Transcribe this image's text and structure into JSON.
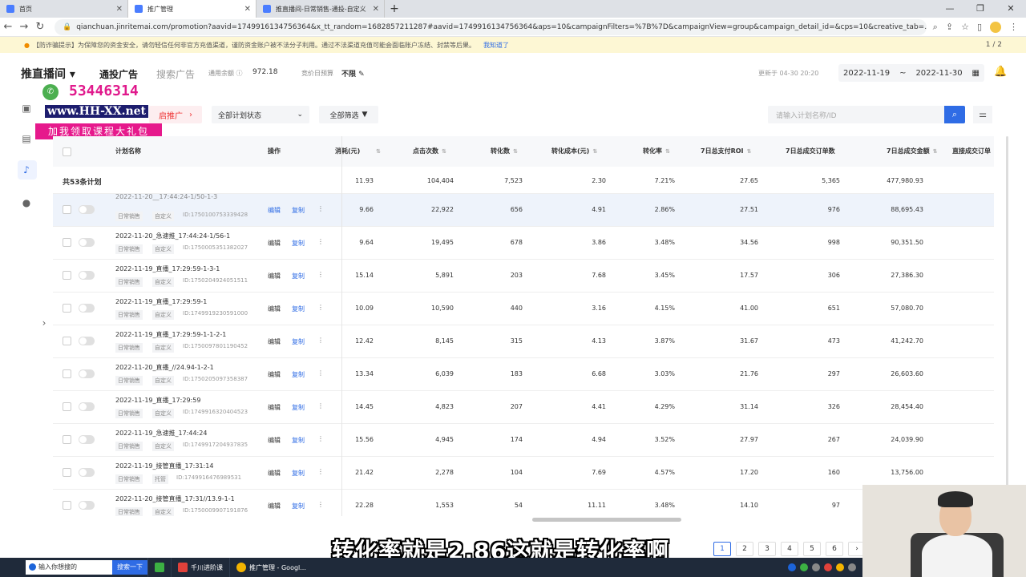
{
  "browser": {
    "tabs": [
      {
        "title": "首页"
      },
      {
        "title": "推广管理"
      },
      {
        "title": "推直播间-日常销售-通投-自定义"
      }
    ],
    "url": "qianchuan.jinritemai.com/promotion?aavid=1749916134756364&x_tt_random=1682857211287#aavid=1749916134756364&aps=10&campaignFilters=%7B%7D&campaignView=group&campaign_detail_id=&cps=10&creative_tab=..."
  },
  "warning": {
    "text": "【防诈骗提示】为保障您的资金安全，请勿轻信任何非官方充值渠道，谨防资金账户被不法分子利用。通过不法渠道充值可能会面临账户冻结、封禁等后果。",
    "link": "我知道了",
    "pager": "1  /  2"
  },
  "header": {
    "title": "推直播间 ▾",
    "tab_active": "通投广告",
    "tab_other": "搜索广告",
    "balance_label": "通用余额 ⓘ",
    "balance_value": "972.18",
    "budget_label": "竞价日预算",
    "budget_value": "不限 ✎",
    "updated": "更新于 04-30 20:20",
    "date_start": "2022-11-19",
    "date_sep": "~",
    "date_end": "2022-11-30"
  },
  "filters": {
    "start_btn": "启推广",
    "status_select": "全部计划状态",
    "all_filter": "全部筛选",
    "search_placeholder": "请输入计划名称/ID"
  },
  "watermark": {
    "phone": "53446314",
    "site": "www.HH-XX.net",
    "gift": "加我领取课程大礼包"
  },
  "table": {
    "headers": {
      "name": "计划名称",
      "op": "操作",
      "cost": "消耗(元)",
      "clicks": "点击次数",
      "conv": "转化数",
      "conv_cost": "转化成本(元)",
      "conv_rate": "转化率",
      "roi7": "7日总支付ROI",
      "orders7": "7日总成交订单数",
      "gmv7": "7日总成交金额",
      "direct": "直接成交订单"
    },
    "summary": {
      "label": "共53条计划",
      "cost": "11.93",
      "clicks": "104,404",
      "conv": "7,523",
      "conv_cost": "2.30",
      "conv_rate": "7.21%",
      "roi7": "27.65",
      "orders7": "5,365",
      "gmv7": "477,980.93"
    },
    "edit_label": "编辑",
    "copy_label": "复制",
    "rows": [
      {
        "name": "2022-11-20__17:44:24-1/50-1-3",
        "tag1": "日常销售",
        "tag2": "自定义",
        "id": "ID:1750100753339428",
        "cost": "9.66",
        "clicks": "22,922",
        "conv": "656",
        "conv_cost": "4.91",
        "conv_rate": "2.86%",
        "roi7": "27.51",
        "orders7": "976",
        "gmv7": "88,695.43",
        "editable": true
      },
      {
        "name": "2022-11-20_急速推_17:44:24-1/56-1",
        "tag1": "日常销售",
        "tag2": "自定义",
        "id": "ID:1750005351382027",
        "cost": "9.64",
        "clicks": "19,495",
        "conv": "678",
        "conv_cost": "3.86",
        "conv_rate": "3.48%",
        "roi7": "34.56",
        "orders7": "998",
        "gmv7": "90,351.50",
        "editable": false
      },
      {
        "name": "2022-11-19_直播_17:29:59-1-3-1",
        "tag1": "日常销售",
        "tag2": "自定义",
        "id": "ID:1750204924051511",
        "cost": "15.14",
        "clicks": "5,891",
        "conv": "203",
        "conv_cost": "7.68",
        "conv_rate": "3.45%",
        "roi7": "17.57",
        "orders7": "306",
        "gmv7": "27,386.30",
        "editable": false
      },
      {
        "name": "2022-11-19_直播_17:29:59-1",
        "tag1": "日常销售",
        "tag2": "自定义",
        "id": "ID:1749919230591000",
        "cost": "10.09",
        "clicks": "10,590",
        "conv": "440",
        "conv_cost": "3.16",
        "conv_rate": "4.15%",
        "roi7": "41.00",
        "orders7": "651",
        "gmv7": "57,080.70",
        "editable": false
      },
      {
        "name": "2022-11-19_直播_17:29:59-1-1-2-1",
        "tag1": "日常销售",
        "tag2": "自定义",
        "id": "ID:1750097801190452",
        "cost": "12.42",
        "clicks": "8,145",
        "conv": "315",
        "conv_cost": "4.13",
        "conv_rate": "3.87%",
        "roi7": "31.67",
        "orders7": "473",
        "gmv7": "41,242.70",
        "editable": false
      },
      {
        "name": "2022-11-20_直播_//24.94-1-2-1",
        "tag1": "日常销售",
        "tag2": "自定义",
        "id": "ID:1750205097358387",
        "cost": "13.34",
        "clicks": "6,039",
        "conv": "183",
        "conv_cost": "6.68",
        "conv_rate": "3.03%",
        "roi7": "21.76",
        "orders7": "297",
        "gmv7": "26,603.60",
        "editable": false
      },
      {
        "name": "2022-11-19_直播_17:29:59",
        "tag1": "日常销售",
        "tag2": "自定义",
        "id": "ID:1749916320404523",
        "cost": "14.45",
        "clicks": "4,823",
        "conv": "207",
        "conv_cost": "4.41",
        "conv_rate": "4.29%",
        "roi7": "31.14",
        "orders7": "326",
        "gmv7": "28,454.40",
        "editable": false
      },
      {
        "name": "2022-11-19_急速推_17:44:24",
        "tag1": "日常销售",
        "tag2": "自定义",
        "id": "ID:1749917204937835",
        "cost": "15.56",
        "clicks": "4,945",
        "conv": "174",
        "conv_cost": "4.94",
        "conv_rate": "3.52%",
        "roi7": "27.97",
        "orders7": "267",
        "gmv7": "24,039.90",
        "editable": false
      },
      {
        "name": "2022-11-19_接管直播_17:31:14",
        "tag1": "日常销售",
        "tag2": "托管",
        "id": "ID:1749916476989531",
        "cost": "21.42",
        "clicks": "2,278",
        "conv": "104",
        "conv_cost": "7.69",
        "conv_rate": "4.57%",
        "roi7": "17.20",
        "orders7": "160",
        "gmv7": "13,756.00",
        "editable": false
      },
      {
        "name": "2022-11-20_接管直播_17:31//13.9-1-1",
        "tag1": "日常销售",
        "tag2": "自定义",
        "id": "ID:1750009907191876",
        "cost": "22.28",
        "clicks": "1,553",
        "conv": "54",
        "conv_cost": "11.11",
        "conv_rate": "3.48%",
        "roi7": "14.10",
        "orders7": "97",
        "gmv7": "",
        "editable": false
      }
    ]
  },
  "pagination": [
    "1",
    "2",
    "3",
    "4",
    "5",
    "6"
  ],
  "subtitle": "转化率就是2.86这就是转化率啊",
  "taskbar": {
    "search": "输入你想搜的",
    "search_btn": "搜索一下",
    "apps": [
      "千川进阶课",
      "推广管理 - Googl..."
    ]
  },
  "colors": {
    "accent": "#2f6ce5",
    "warning_bg": "#fdf7d4",
    "start_red": "#e33333"
  }
}
